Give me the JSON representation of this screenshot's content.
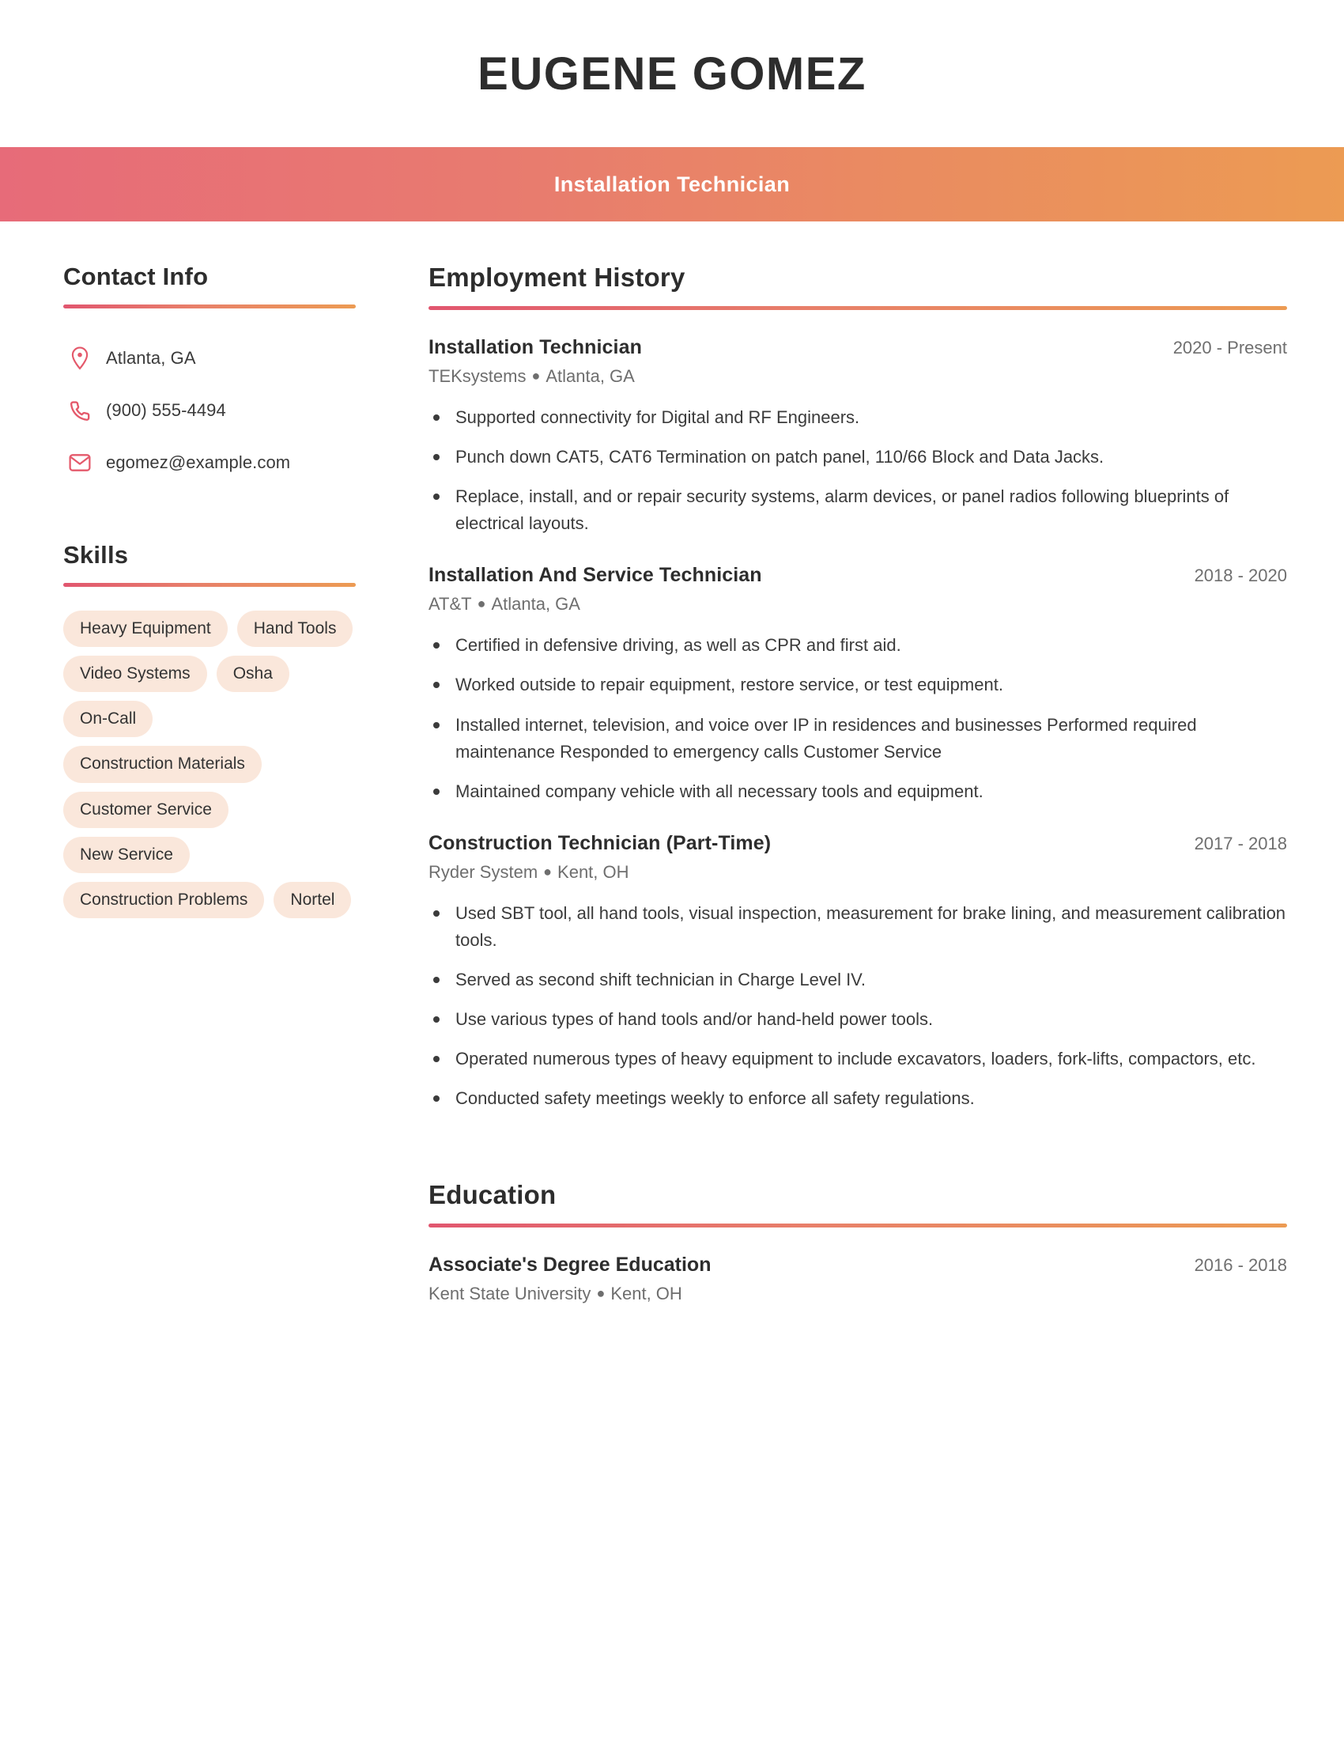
{
  "header": {
    "name": "EUGENE GOMEZ",
    "job_title": "Installation Technician",
    "gradient_start": "#e76b79",
    "gradient_end": "#ec9b53"
  },
  "sidebar": {
    "contact": {
      "heading": "Contact Info",
      "items": [
        {
          "icon": "location-pin-icon",
          "text": "Atlanta, GA"
        },
        {
          "icon": "phone-icon",
          "text": "(900) 555-4494"
        },
        {
          "icon": "envelope-icon",
          "text": "egomez@example.com"
        }
      ]
    },
    "skills": {
      "heading": "Skills",
      "pill_color": "#fae7db",
      "items": [
        "Heavy Equipment",
        "Hand Tools",
        "Video Systems",
        "Osha",
        "On-Call",
        "Construction Materials",
        "Customer Service",
        "New Service",
        "Construction Problems",
        "Nortel"
      ]
    }
  },
  "main": {
    "employment": {
      "heading": "Employment History",
      "jobs": [
        {
          "role": "Installation Technician",
          "dates": "2020 - Present",
          "company": "TEKsystems",
          "location": "Atlanta, GA",
          "bullets": [
            "Supported connectivity for Digital and RF Engineers.",
            "Punch down CAT5, CAT6 Termination on patch panel, 110/66 Block and Data Jacks.",
            "Replace, install, and or repair security systems, alarm devices, or panel radios following blueprints of electrical layouts."
          ]
        },
        {
          "role": "Installation And Service Technician",
          "dates": "2018 - 2020",
          "company": "AT&T",
          "location": "Atlanta, GA",
          "bullets": [
            "Certified in defensive driving, as well as CPR and first aid.",
            "Worked outside to repair equipment, restore service, or test equipment.",
            "Installed internet, television, and voice over IP in residences and businesses Performed required maintenance Responded to emergency calls Customer Service",
            "Maintained company vehicle with all necessary tools and equipment."
          ]
        },
        {
          "role": "Construction Technician (Part-Time)",
          "dates": "2017 - 2018",
          "company": "Ryder System",
          "location": "Kent, OH",
          "bullets": [
            "Used SBT tool, all hand tools, visual inspection, measurement for brake lining, and measurement calibration tools.",
            "Served as second shift technician in Charge Level IV.",
            "Use various types of hand tools and/or hand-held power tools.",
            "Operated numerous types of heavy equipment to include excavators, loaders, fork-lifts, compactors, etc.",
            "Conducted safety meetings weekly to enforce all safety regulations."
          ]
        }
      ]
    },
    "education": {
      "heading": "Education",
      "entries": [
        {
          "degree": "Associate's Degree Education",
          "dates": "2016 - 2018",
          "school": "Kent State University",
          "location": "Kent, OH"
        }
      ]
    }
  }
}
